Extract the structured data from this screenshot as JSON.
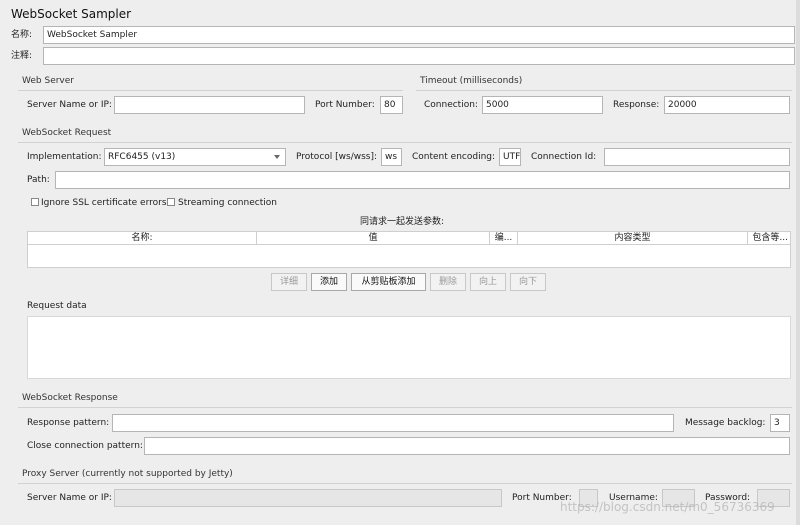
{
  "header": {
    "title": "WebSocket Sampler"
  },
  "general": {
    "name_label": "名称:",
    "name_value": "WebSocket Sampler",
    "comment_label": "注释:",
    "comment_value": ""
  },
  "web_server": {
    "section": "Web Server",
    "server_label": "Server Name or IP:",
    "server_value": "",
    "port_label": "Port Number:",
    "port_value": "80"
  },
  "timeout": {
    "section": "Timeout (milliseconds)",
    "connection_label": "Connection:",
    "connection_value": "5000",
    "response_label": "Response:",
    "response_value": "20000"
  },
  "request": {
    "section": "WebSocket Request",
    "implementation_label": "Implementation:",
    "implementation_value": "RFC6455 (v13)",
    "protocol_label": "Protocol [ws/wss]:",
    "protocol_value": "ws",
    "encoding_label": "Content encoding:",
    "encoding_value": "UTF",
    "connection_id_label": "Connection Id:",
    "connection_id_value": "",
    "path_label": "Path:",
    "path_value": "",
    "ignore_ssl_label": "Ignore SSL certificate errors",
    "streaming_label": "Streaming connection",
    "params_caption": "同请求一起发送参数:",
    "columns": [
      "名称:",
      "值",
      "编...",
      "内容类型",
      "包含等..."
    ],
    "buttons": {
      "detail": "详细",
      "add": "添加",
      "add_clipboard": "从剪贴板添加",
      "delete": "删除",
      "up": "向上",
      "down": "向下"
    },
    "request_data_label": "Request data"
  },
  "response": {
    "section": "WebSocket Response",
    "pattern_label": "Response pattern:",
    "pattern_value": "",
    "backlog_label": "Message backlog:",
    "backlog_value": "3",
    "close_label": "Close connection pattern:",
    "close_value": ""
  },
  "proxy": {
    "section": "Proxy Server (currently not supported by Jetty)",
    "server_label": "Server Name or IP:",
    "port_label": "Port Number:",
    "username_label": "Username:",
    "password_label": "Password:"
  },
  "watermark": "https://blog.csdn.net/m0_56736369"
}
